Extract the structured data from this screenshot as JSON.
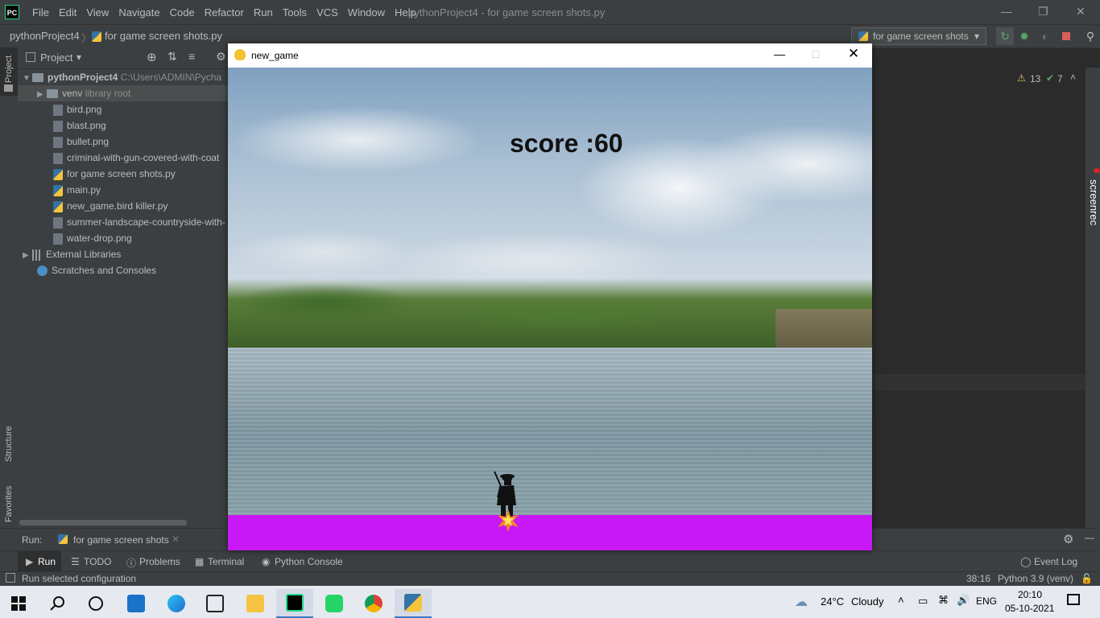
{
  "ide": {
    "app_badge": "PC",
    "menu": [
      "File",
      "Edit",
      "View",
      "Navigate",
      "Code",
      "Refactor",
      "Run",
      "Tools",
      "VCS",
      "Window",
      "Help"
    ],
    "window_title": "pythonProject4 - for game screen shots.py",
    "breadcrumb_project": "pythonProject4",
    "breadcrumb_file": "for game screen shots.py",
    "run_config": "for game screen shots",
    "warnings": "13",
    "checks": "7",
    "left_tools": [
      "Project",
      "Structure",
      "Favorites"
    ],
    "right_tools": [
      "screenrec"
    ]
  },
  "project_panel": {
    "title": "Project",
    "root_name": "pythonProject4",
    "root_path": "C:\\Users\\ADMIN\\Pycha",
    "venv_name": "venv",
    "venv_tag": "library root",
    "files": [
      {
        "name": "bird.png",
        "type": "image"
      },
      {
        "name": "blast.png",
        "type": "image"
      },
      {
        "name": "bullet.png",
        "type": "image"
      },
      {
        "name": "criminal-with-gun-covered-with-coat",
        "type": "image"
      },
      {
        "name": "for game screen shots.py",
        "type": "python"
      },
      {
        "name": "main.py",
        "type": "python"
      },
      {
        "name": "new_game.bird killer.py",
        "type": "python"
      },
      {
        "name": "summer-landscape-countryside-with-",
        "type": "image"
      },
      {
        "name": "water-drop.png",
        "type": "image"
      }
    ],
    "external_libraries": "External Libraries",
    "scratches": "Scratches and Consoles"
  },
  "game": {
    "window_title": "new_game",
    "score_text": "score :60",
    "ground_color": "#c718f5"
  },
  "run_panel": {
    "label": "Run:",
    "tab": "for game screen shots"
  },
  "tool_windows": [
    "Run",
    "TODO",
    "Problems",
    "Terminal",
    "Python Console"
  ],
  "event_log": "Event Log",
  "status": {
    "message": "Run selected configuration",
    "position": "38:16",
    "interpreter": "Python 3.9 (venv)"
  },
  "taskbar": {
    "weather_temp": "24°C",
    "weather_desc": "Cloudy",
    "language": "ENG",
    "time": "20:10",
    "date": "05-10-2021"
  }
}
